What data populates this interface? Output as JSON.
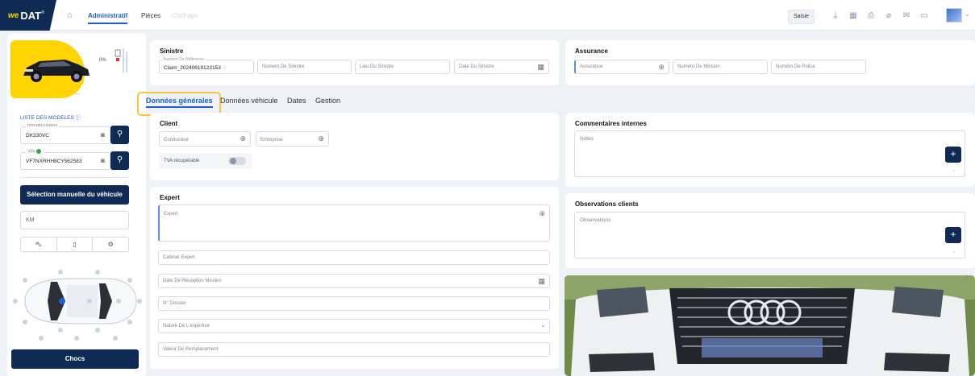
{
  "brand": {
    "we": "we",
    "dat": "DAT",
    "reg": "®"
  },
  "nav": {
    "tabs": [
      {
        "label": "Administratif",
        "state": "active"
      },
      {
        "label": "Pièces",
        "state": "normal"
      },
      {
        "label": "Chiffrage",
        "state": "disabled"
      }
    ]
  },
  "toolbar": {
    "saisie_label": "Saisie",
    "icons": [
      "download-icon",
      "calendar-icon",
      "print-icon",
      "attach-icon",
      "mail-icon",
      "chat-icon"
    ]
  },
  "sidebar": {
    "damage_pct": "0%",
    "dash": "—",
    "models_link": "LISTE DES MODELES",
    "immatriculation": {
      "label": "Immatriculation",
      "value": "DK330VC"
    },
    "vin": {
      "label": "VIN",
      "value": "VF7NXRHH8CY562583"
    },
    "manual_btn": "Sélection manuelle du véhicule",
    "km_placeholder": "KM",
    "chocs_btn": "Chocs"
  },
  "sinistre": {
    "title": "Sinistre",
    "reference": {
      "label": "Numéro De Référence",
      "value": "Claim_20240619123153"
    },
    "numero": "Numero De Sinistre",
    "lieu": "Lieu Du Sinistre",
    "date": "Date Du Sinistre"
  },
  "assurance": {
    "title": "Assurance",
    "assurance": "Assurance",
    "mission": "Numéro De Mission",
    "police": "Numéro De Police"
  },
  "tabs": [
    {
      "label": "Données générales",
      "active": true
    },
    {
      "label": "Données véhicule",
      "active": false
    },
    {
      "label": "Dates",
      "active": false
    },
    {
      "label": "Gestion",
      "active": false
    }
  ],
  "client": {
    "title": "Client",
    "conducteur": "Conducteur",
    "entreprise": "Entreprise",
    "tva": "TVA récupérable"
  },
  "expert": {
    "title": "Expert",
    "expert": "Expert",
    "cabinet": "Cabinet Expert",
    "date_reception": "Date De Réception Mission",
    "dossier": "N° Dossier",
    "nature": "Nature De L'expertise",
    "valeur": "Valeur De Remplacement"
  },
  "commentaires": {
    "title": "Commentaires internes",
    "placeholder": "Notes"
  },
  "observations": {
    "title": "Observations clients",
    "placeholder": "Observations"
  },
  "colors": {
    "navy": "#0f2b55",
    "accent": "#1d5fd0",
    "yellow": "#ffd400",
    "highlight": "#f5c542"
  }
}
